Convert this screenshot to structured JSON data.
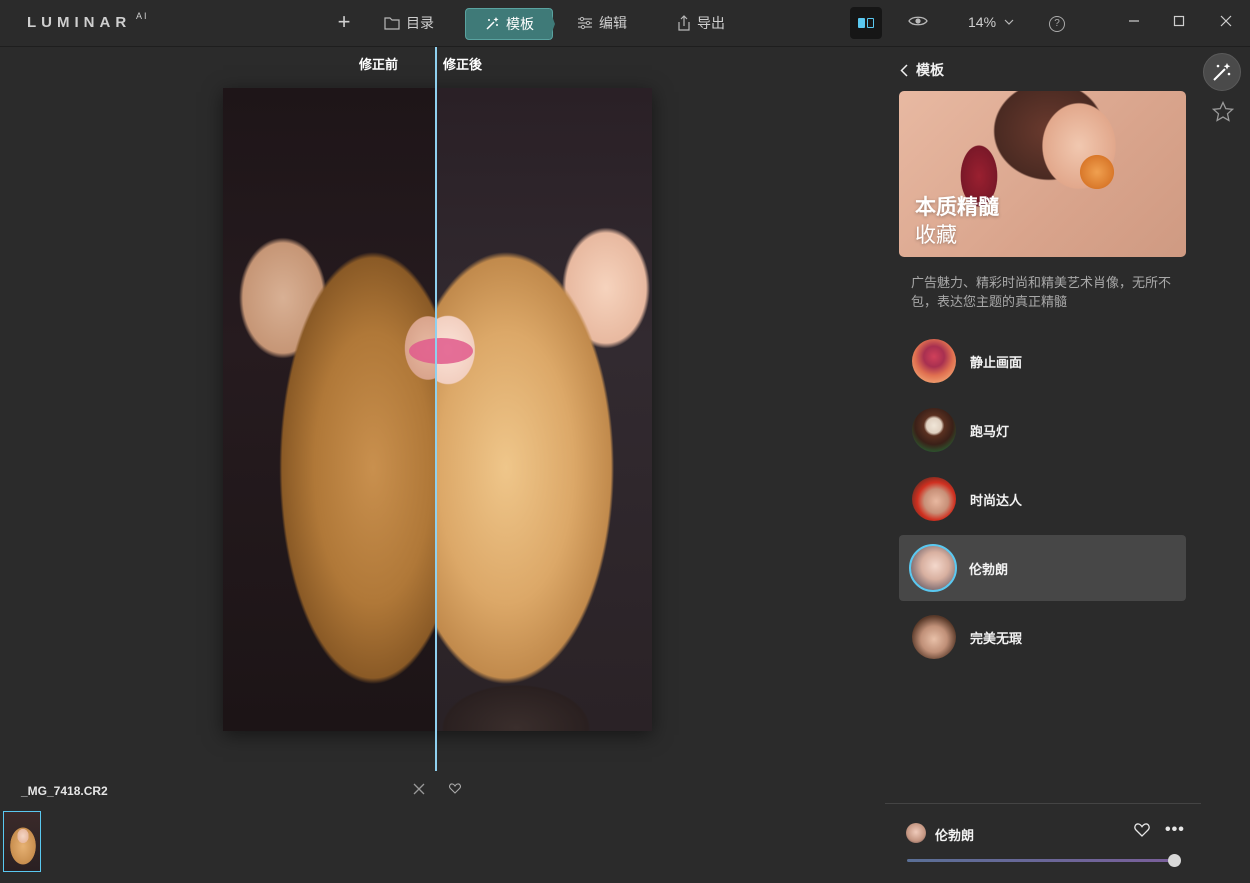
{
  "app": {
    "logo": "LUMINAR",
    "logo_sup": "AI"
  },
  "topbar": {
    "add_label": "+",
    "catalog_label": "目录",
    "templates_label": "模板",
    "edit_label": "编辑",
    "export_label": "导出",
    "zoom_value": "14%",
    "help_label": "?"
  },
  "canvas": {
    "before_label": "修正前",
    "after_label": "修正後",
    "filename": "_MG_7418.CR2"
  },
  "panel": {
    "back_title": "模板",
    "hero": {
      "title": "本质精髓",
      "subtitle": "收藏"
    },
    "description": "广告魅力、精彩时尚和精美艺术肖像，无所不包，表达您主题的真正精髓",
    "items": [
      {
        "label": "静止画面"
      },
      {
        "label": "跑马灯"
      },
      {
        "label": "时尚达人"
      },
      {
        "label": "伦勃朗"
      },
      {
        "label": "完美无瑕"
      }
    ],
    "selected": {
      "label": "伦勃朗",
      "more": "•••",
      "amount": 1.0
    }
  },
  "colors": {
    "accent": "#5ac8f0",
    "active_tab": "#3f7a78",
    "background": "#2b2b2b",
    "selected_item": "#474747"
  },
  "icons": {
    "catalog": "folder-icon",
    "templates": "magic-wand-icon",
    "edit": "sliders-icon",
    "export": "share-icon",
    "view": "eye-icon",
    "favorites": "star-icon"
  }
}
